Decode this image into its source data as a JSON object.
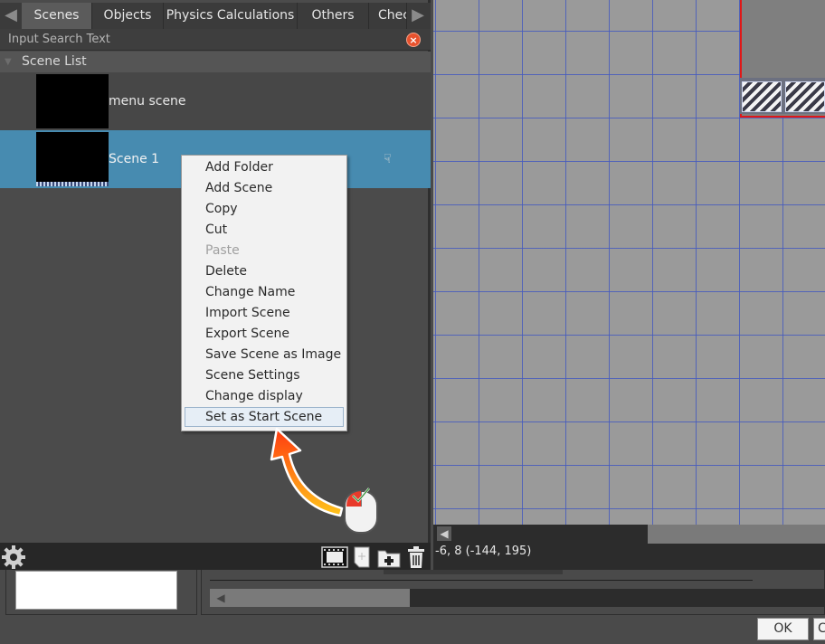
{
  "tabs": [
    "Scenes",
    "Objects",
    "Physics Calculations",
    "Others",
    "Checl"
  ],
  "search": {
    "placeholder": "Input Search Text"
  },
  "scene_list": {
    "title": "Scene List",
    "scenes": [
      {
        "name": "menu scene"
      },
      {
        "name": "Scene 1"
      }
    ]
  },
  "context_menu": {
    "items": [
      {
        "label": "Add Folder",
        "enabled": true
      },
      {
        "label": "Add Scene",
        "enabled": true
      },
      {
        "label": "Copy",
        "enabled": true
      },
      {
        "label": "Cut",
        "enabled": true
      },
      {
        "label": "Paste",
        "enabled": false
      },
      {
        "label": "Delete",
        "enabled": true
      },
      {
        "label": "Change Name",
        "enabled": true
      },
      {
        "label": "Import Scene",
        "enabled": true
      },
      {
        "label": "Export Scene",
        "enabled": true
      },
      {
        "label": "Save Scene as Image",
        "enabled": true
      },
      {
        "label": "Scene Settings",
        "enabled": true
      },
      {
        "label": "Change display",
        "enabled": true
      },
      {
        "label": "Set as Start Scene",
        "enabled": true,
        "selected": true
      }
    ]
  },
  "status": {
    "coordinates": "-6, 8 (-144, 195)"
  },
  "dialog": {
    "ok_label": "OK",
    "cancel_label": "C"
  },
  "colors": {
    "selected_row": "#478bb0",
    "canvas_bg": "#9a9a9a",
    "grid_line": "#465abe",
    "region_border": "#e01818"
  },
  "icons": [
    "tab-prev-arrow-icon",
    "tab-next-arrow-icon",
    "clear-search-icon",
    "collapse-caret-icon",
    "cursor-icon",
    "mouse-icon",
    "gear-icon",
    "film-icon",
    "new-scene-icon",
    "new-folder-icon",
    "trash-icon"
  ]
}
